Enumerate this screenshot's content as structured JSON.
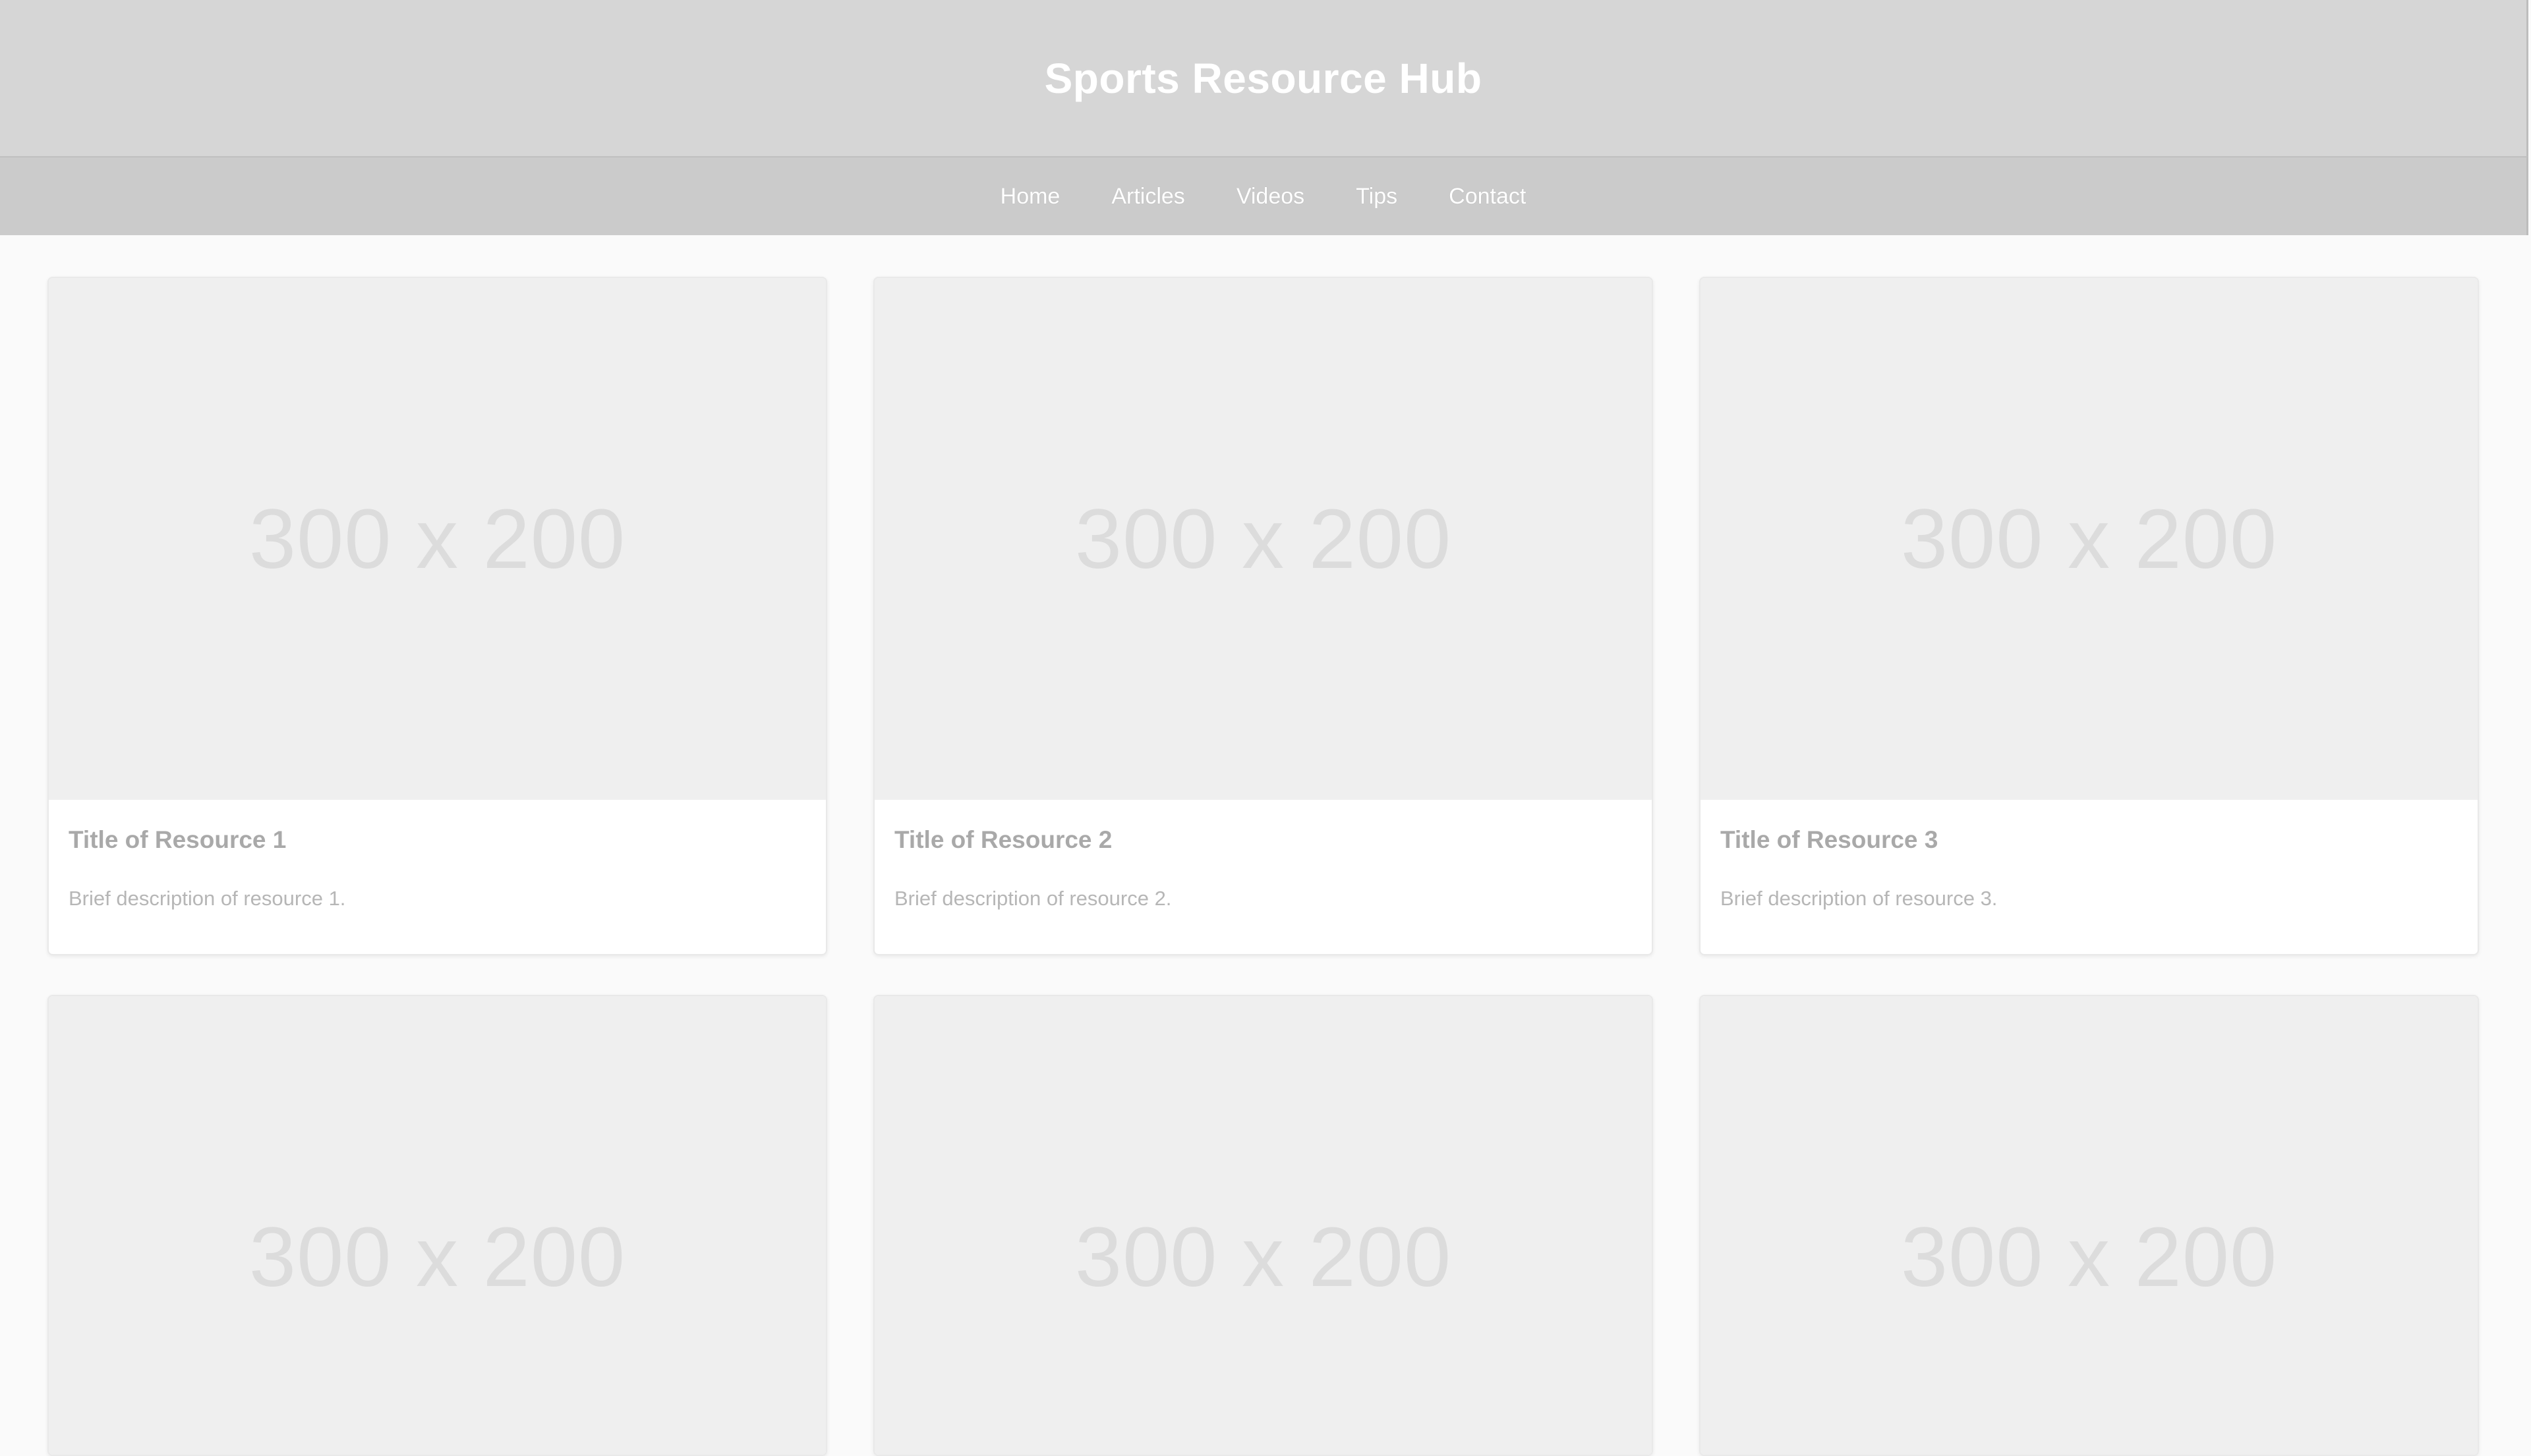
{
  "header": {
    "title": "Sports Resource Hub"
  },
  "nav": {
    "items": [
      "Home",
      "Articles",
      "Videos",
      "Tips",
      "Contact"
    ]
  },
  "cards": [
    {
      "image_text": "300 x 200",
      "title": "Title of Resource 1",
      "description": "Brief description of resource 1."
    },
    {
      "image_text": "300 x 200",
      "title": "Title of Resource 2",
      "description": "Brief description of resource 2."
    },
    {
      "image_text": "300 x 200",
      "title": "Title of Resource 3",
      "description": "Brief description of resource 3."
    },
    {
      "image_text": "300 x 200"
    },
    {
      "image_text": "300 x 200"
    },
    {
      "image_text": "300 x 200"
    }
  ],
  "colors": {
    "header_bg": "#d6d6d6",
    "nav_bg": "#cbcbcb",
    "page_bg": "#fafafa",
    "placeholder_bg": "#efefef"
  }
}
